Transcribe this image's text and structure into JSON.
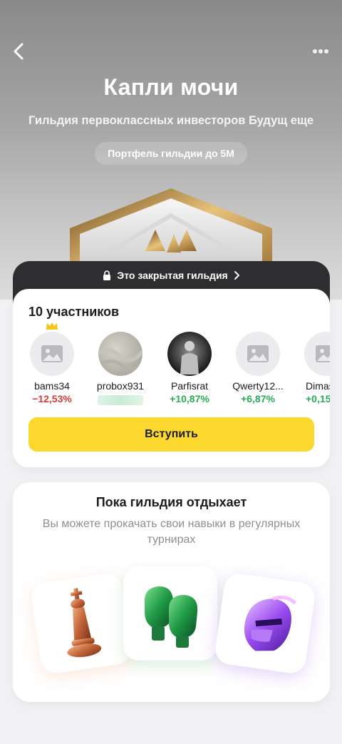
{
  "header": {
    "title": "Капли мочи",
    "subtitle": "Гильдия первоклассных инвесторов Будущ еще",
    "portfolio_pill": "Портфель гильдии до 5М",
    "back_icon": "chevron-left-icon",
    "more_icon": "more-dots-icon"
  },
  "closed_notice": {
    "label": "Это закрытая гильдия",
    "lock_icon": "lock-icon",
    "chevron_icon": "chevron-right-icon"
  },
  "members": {
    "title": "10 участников",
    "items": [
      {
        "name": "bams34",
        "change": "−12,53%",
        "trend": "neg",
        "avatar": "placeholder-image-icon",
        "leader": true
      },
      {
        "name": "probox931",
        "change": "",
        "trend": "hidden",
        "avatar": "fabric-photo"
      },
      {
        "name": "Parfisrat",
        "change": "+10,87%",
        "trend": "pos",
        "avatar": "athlete-photo"
      },
      {
        "name": "Qwerty12...",
        "change": "+6,87%",
        "trend": "pos",
        "avatar": "placeholder-image-icon"
      },
      {
        "name": "Dimas",
        "change": "+0,15",
        "trend": "pos",
        "avatar": "placeholder-image-icon"
      }
    ]
  },
  "join_button": {
    "label": "Вступить"
  },
  "rest_card": {
    "title": "Пока гильдия отдыхает",
    "text": "Вы можете прокачать свои навыки в регулярных турнирах",
    "tiles": [
      "chess-king-icon",
      "boxing-gloves-icon",
      "knight-helmet-icon"
    ]
  },
  "colors": {
    "accent_yellow": "#fcd82f",
    "negative": "#d63b3b",
    "positive": "#2aaa58",
    "dark_band": "#2e2e30"
  }
}
